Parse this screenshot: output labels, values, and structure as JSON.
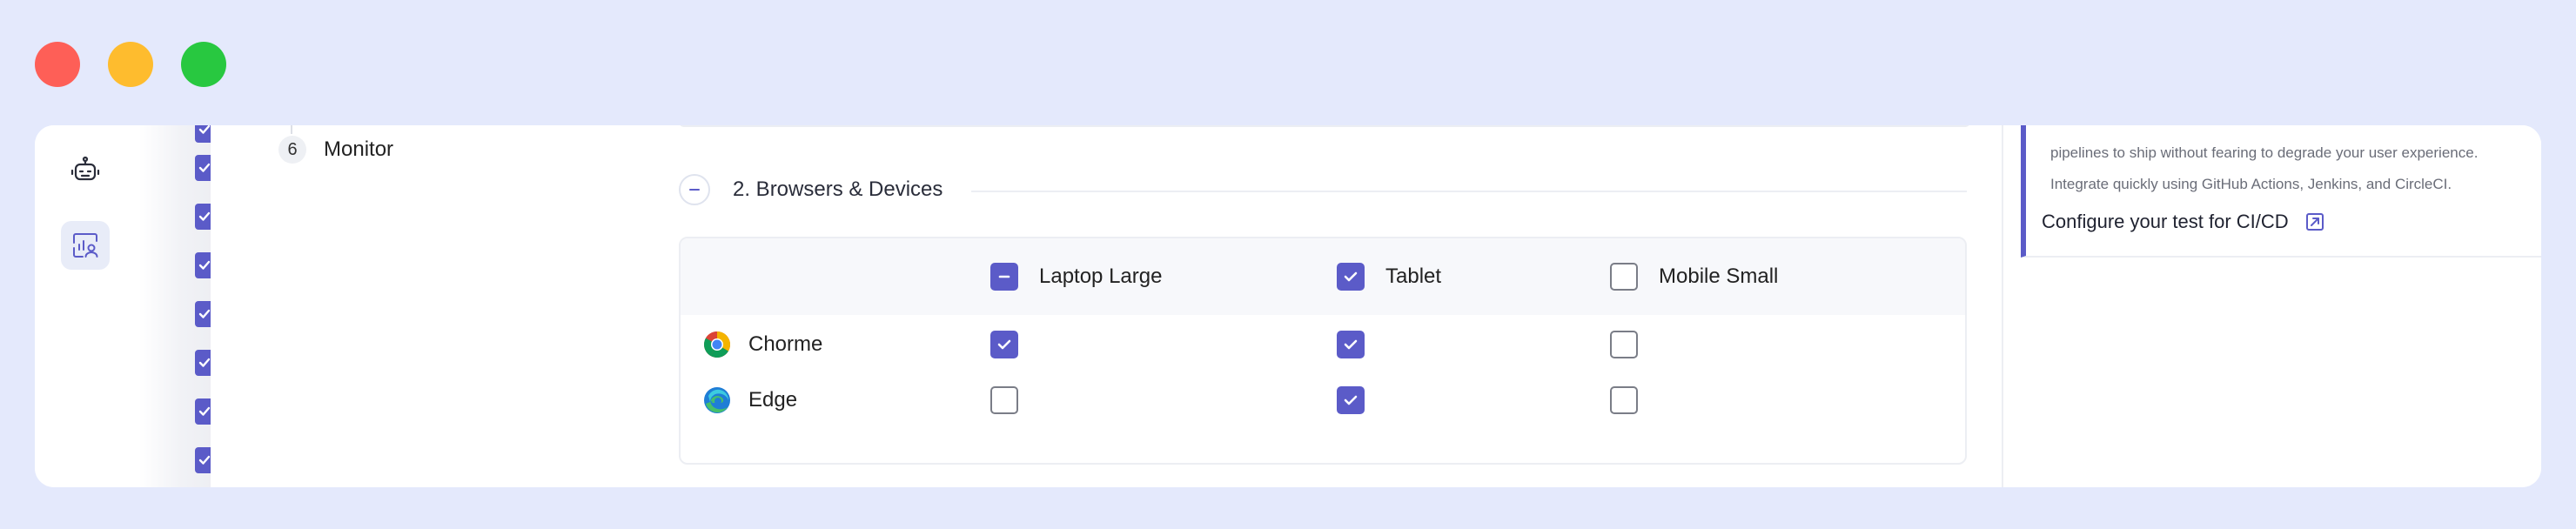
{
  "window": {
    "controls": [
      "close",
      "minimize",
      "maximize"
    ]
  },
  "rail": {
    "items": [
      {
        "icon": "robot-icon",
        "active": false
      },
      {
        "icon": "user-analytics-icon",
        "active": true
      }
    ]
  },
  "steps": {
    "visible_step": {
      "number": "6",
      "label": "Monitor"
    }
  },
  "section": {
    "title": "2. Browsers & Devices",
    "toggle_icon": "minus-icon"
  },
  "matrix": {
    "columns": [
      {
        "label": "Laptop Large",
        "state": "indeterminate"
      },
      {
        "label": "Tablet",
        "state": "checked"
      },
      {
        "label": "Mobile Small",
        "state": "unchecked"
      }
    ],
    "rows": [
      {
        "label": "Chorme",
        "icon": "chrome-icon",
        "cells": [
          true,
          true,
          false
        ]
      },
      {
        "label": "Edge",
        "icon": "edge-icon",
        "cells": [
          false,
          true,
          false
        ]
      }
    ]
  },
  "info": {
    "line_partial": "pipelines to ship without fearing to degrade your user experience.",
    "line_integrate": "Integrate quickly using GitHub Actions, Jenkins, and CircleCI.",
    "link_label": "Configure your test for CI/CD",
    "link_icon": "external-link-icon"
  },
  "colors": {
    "accent": "#5b5bc8",
    "background": "#e4e9fc",
    "close": "#fe5f57",
    "minimize": "#febc2e",
    "maximize": "#28c840"
  }
}
